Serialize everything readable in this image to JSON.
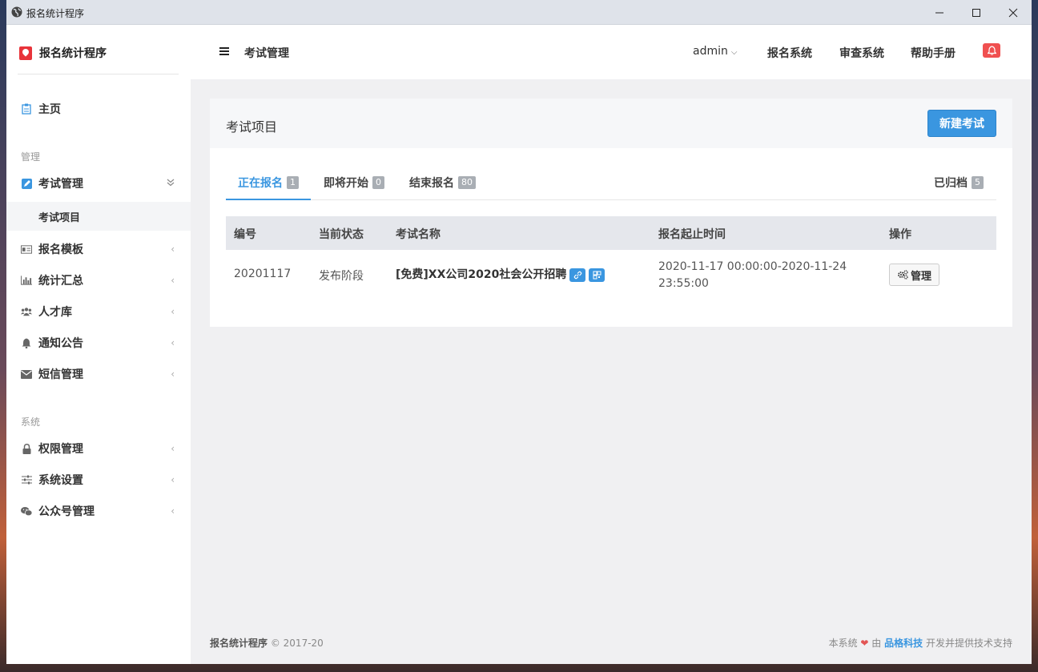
{
  "window": {
    "title": "报名统计程序"
  },
  "sidebar": {
    "brand": "报名统计程序",
    "home": "主页",
    "section_manage": "管理",
    "exam_manage": "考试管理",
    "exam_items": "考试项目",
    "items": [
      {
        "label": "报名模板",
        "icon": "id-card-icon"
      },
      {
        "label": "统计汇总",
        "icon": "bar-chart-icon"
      },
      {
        "label": "人才库",
        "icon": "users-icon"
      },
      {
        "label": "通知公告",
        "icon": "bell-icon"
      },
      {
        "label": "短信管理",
        "icon": "envelope-icon"
      }
    ],
    "section_system": "系统",
    "system_items": [
      {
        "label": "权限管理",
        "icon": "lock-icon"
      },
      {
        "label": "系统设置",
        "icon": "sliders-icon"
      },
      {
        "label": "公众号管理",
        "icon": "wechat-icon"
      }
    ]
  },
  "header": {
    "breadcrumb": "考试管理",
    "user": "admin",
    "links": [
      "报名系统",
      "审查系统",
      "帮助手册"
    ]
  },
  "panel": {
    "title": "考试项目",
    "new_button": "新建考试",
    "tabs": [
      {
        "label": "正在报名",
        "count": "1"
      },
      {
        "label": "即将开始",
        "count": "0"
      },
      {
        "label": "结束报名",
        "count": "80"
      }
    ],
    "archived": {
      "label": "已归档",
      "count": "5"
    },
    "columns": [
      "编号",
      "当前状态",
      "考试名称",
      "报名起止时间",
      "操作"
    ],
    "rows": [
      {
        "id": "20201117",
        "status": "发布阶段",
        "name": "[免费]XX公司2020社会公开招聘",
        "time_line1": "2020-11-17 00:00:00-2020-11-24",
        "time_line2": "23:55:00",
        "action": "管理"
      }
    ]
  },
  "footer": {
    "app": "报名统计程序",
    "copyright": "© 2017-20",
    "prefix": "本系统",
    "by": "由",
    "company": "品格科技",
    "suffix": "开发并提供技术支持"
  },
  "colors": {
    "accent": "#3a96e0",
    "brand_red": "#e8333a",
    "bell": "#f05050"
  }
}
